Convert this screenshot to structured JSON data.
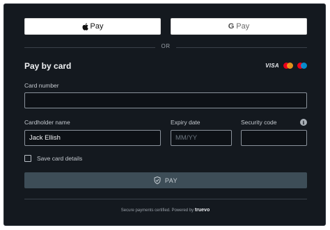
{
  "wallet": {
    "apple_pay_label": "Pay",
    "google_pay_label": "Pay",
    "google_g": "G"
  },
  "divider": {
    "or_label": "OR"
  },
  "card_section": {
    "title": "Pay by card",
    "brands": {
      "visa": "VISA"
    }
  },
  "fields": {
    "card_number": {
      "label": "Card number",
      "value": ""
    },
    "cardholder": {
      "label": "Cardholder name",
      "value": "Jack Ellish"
    },
    "expiry": {
      "label": "Expiry date",
      "placeholder": "MM/YY"
    },
    "security": {
      "label": "Security code",
      "value": ""
    }
  },
  "save_card": {
    "label": "Save card details",
    "checked": false
  },
  "pay_button": {
    "label": "PAY"
  },
  "footer": {
    "text": "Secure payments certified. Powered by",
    "brand": "truevo"
  },
  "colors": {
    "background": "#14191f",
    "field_border": "#8a929b",
    "pay_button_bg": "#3d4d57",
    "mc_red": "#eb001b",
    "mc_orange": "#f79e1b",
    "maestro_blue": "#0099df"
  },
  "icons": [
    "apple-icon",
    "google-icon",
    "visa-logo",
    "mastercard-logo",
    "maestro-logo",
    "info-icon",
    "shield-check-icon"
  ]
}
